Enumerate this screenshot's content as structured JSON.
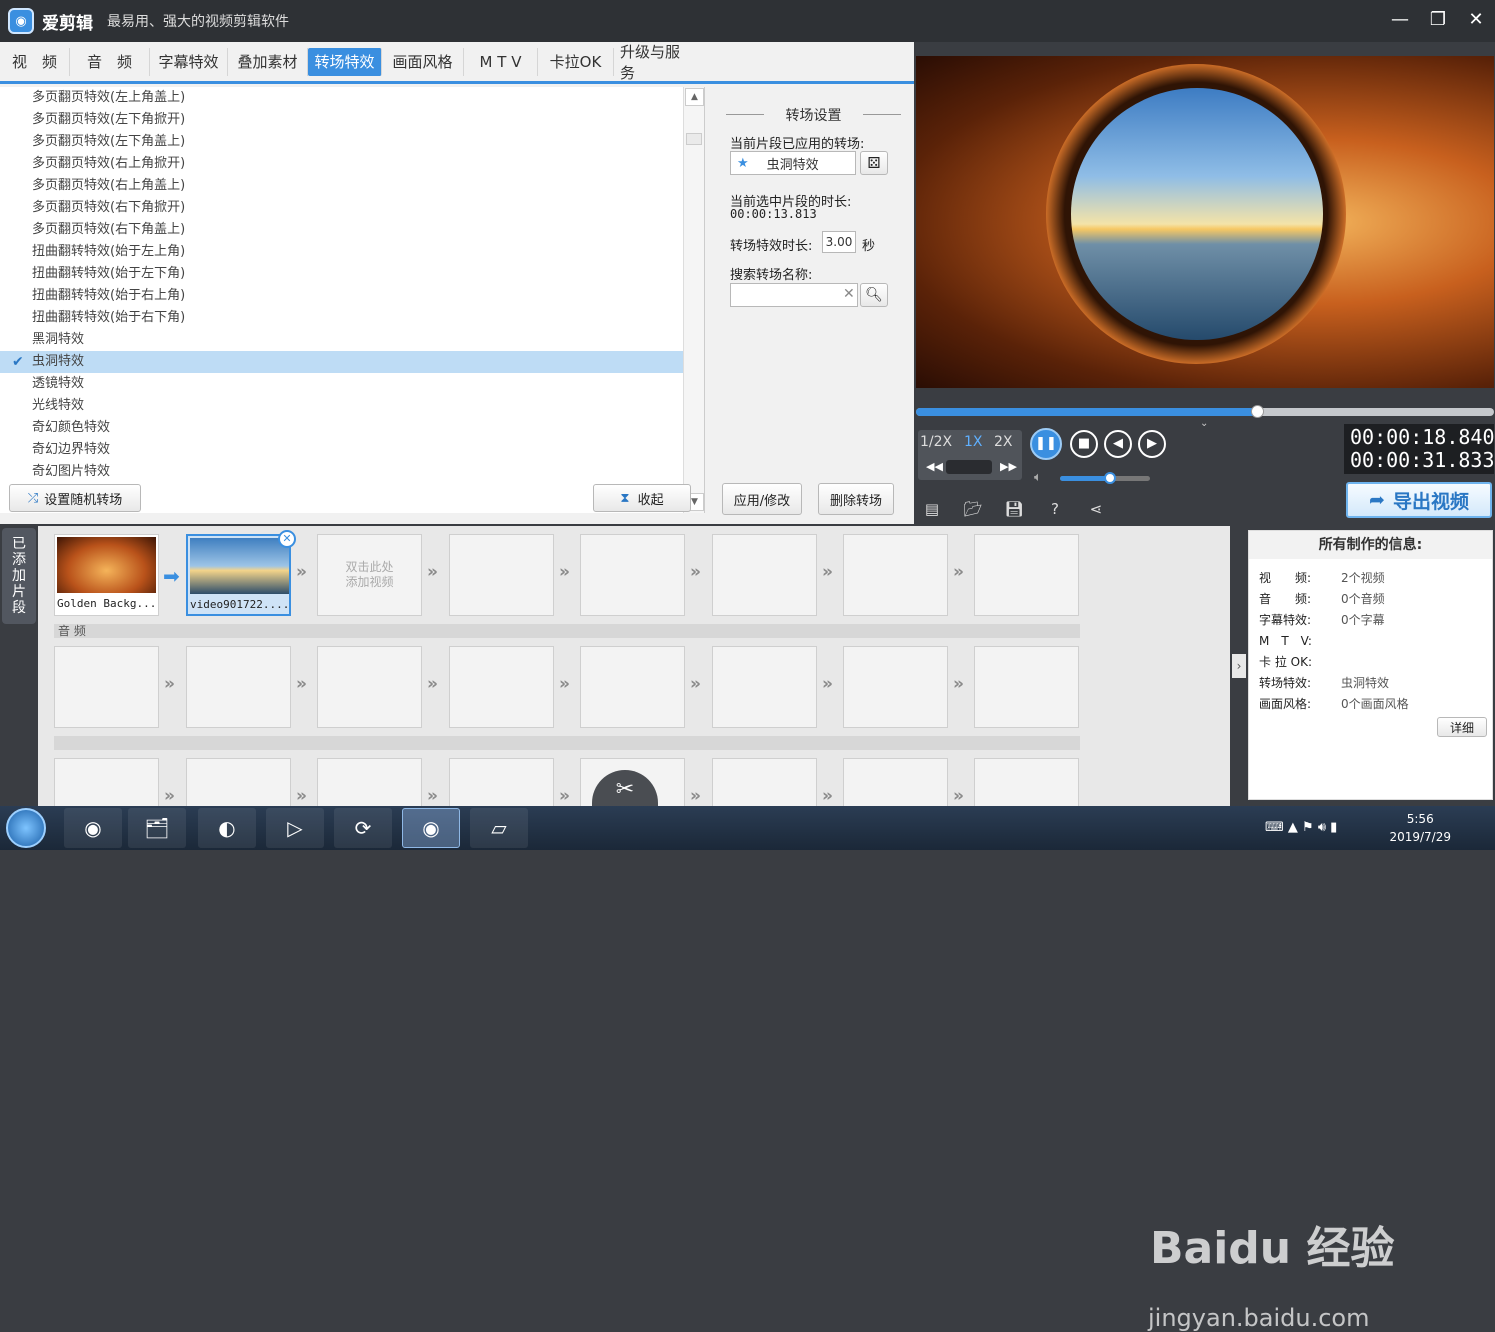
{
  "app": {
    "name": "爱剪辑",
    "slogan": "最易用、强大的视频剪辑软件"
  },
  "tabs": [
    "视　频",
    "音　频",
    "字幕特效",
    "叠加素材",
    "转场特效",
    "画面风格",
    "M T V",
    "卡拉OK",
    "升级与服务"
  ],
  "active_tab": "转场特效",
  "transitions": [
    {
      "label": "多页翻页特效(左上角盖上)",
      "selected": false
    },
    {
      "label": "多页翻页特效(左下角掀开)",
      "selected": false
    },
    {
      "label": "多页翻页特效(左下角盖上)",
      "selected": false
    },
    {
      "label": "多页翻页特效(右上角掀开)",
      "selected": false
    },
    {
      "label": "多页翻页特效(右上角盖上)",
      "selected": false
    },
    {
      "label": "多页翻页特效(右下角掀开)",
      "selected": false
    },
    {
      "label": "多页翻页特效(右下角盖上)",
      "selected": false
    },
    {
      "label": "扭曲翻转特效(始于左上角)",
      "selected": false
    },
    {
      "label": "扭曲翻转特效(始于左下角)",
      "selected": false
    },
    {
      "label": "扭曲翻转特效(始于右上角)",
      "selected": false
    },
    {
      "label": "扭曲翻转特效(始于右下角)",
      "selected": false
    },
    {
      "label": "黑洞特效",
      "selected": false
    },
    {
      "label": "虫洞特效",
      "selected": true
    },
    {
      "label": "透镜特效",
      "selected": false
    },
    {
      "label": "光线特效",
      "selected": false
    },
    {
      "label": "奇幻颜色特效",
      "selected": false
    },
    {
      "label": "奇幻边界特效",
      "selected": false
    },
    {
      "label": "奇幻图片特效",
      "selected": false
    }
  ],
  "left_buttons": {
    "random": "设置随机转场",
    "collapse": "收起"
  },
  "settings": {
    "title": "转场设置",
    "applied_label": "当前片段已应用的转场:",
    "applied_value": "虫洞特效",
    "duration_label": "当前选中片段的时长:",
    "duration_value": "00:00:13.813",
    "effect_duration_label": "转场特效时长:",
    "effect_duration_value": "3.00",
    "effect_duration_unit": "秒",
    "search_label": "搜索转场名称:",
    "search_value": "",
    "apply_button": "应用/修改",
    "delete_button": "删除转场"
  },
  "player": {
    "speeds": [
      "1/2X",
      "1X",
      "2X"
    ],
    "active_speed": "1X",
    "progress": 0.59,
    "volume": 0.55,
    "current_time": "00:00:18.840",
    "total_time": "00:00:31.833",
    "export_label": "导出视频"
  },
  "timeline": {
    "side_tab": "已添加片段",
    "clips": [
      {
        "caption": "Golden Backg...",
        "has_thumb": true
      },
      {
        "caption": "video901722....",
        "has_thumb": true,
        "selected": true
      }
    ],
    "placeholder": "双击此处添加视频",
    "audio_label": "音 频"
  },
  "info": {
    "title": "所有制作的信息:",
    "rows": [
      {
        "k": "视　　频:",
        "v": "2个视频"
      },
      {
        "k": "音　　频:",
        "v": "0个音频"
      },
      {
        "k": "字幕特效:",
        "v": "0个字幕"
      },
      {
        "k": "M　T　V:",
        "v": ""
      },
      {
        "k": "卡 拉 OK:",
        "v": ""
      },
      {
        "k": "转场特效:",
        "v": "虫洞特效"
      },
      {
        "k": "画面风格:",
        "v": "0个画面风格"
      }
    ],
    "detail_button": "详细"
  },
  "taskbar": {
    "time": "5:56",
    "date": "2019/7/29"
  },
  "watermark": {
    "line1": "Baidu 经验",
    "line2": "jingyan.baidu.com"
  }
}
